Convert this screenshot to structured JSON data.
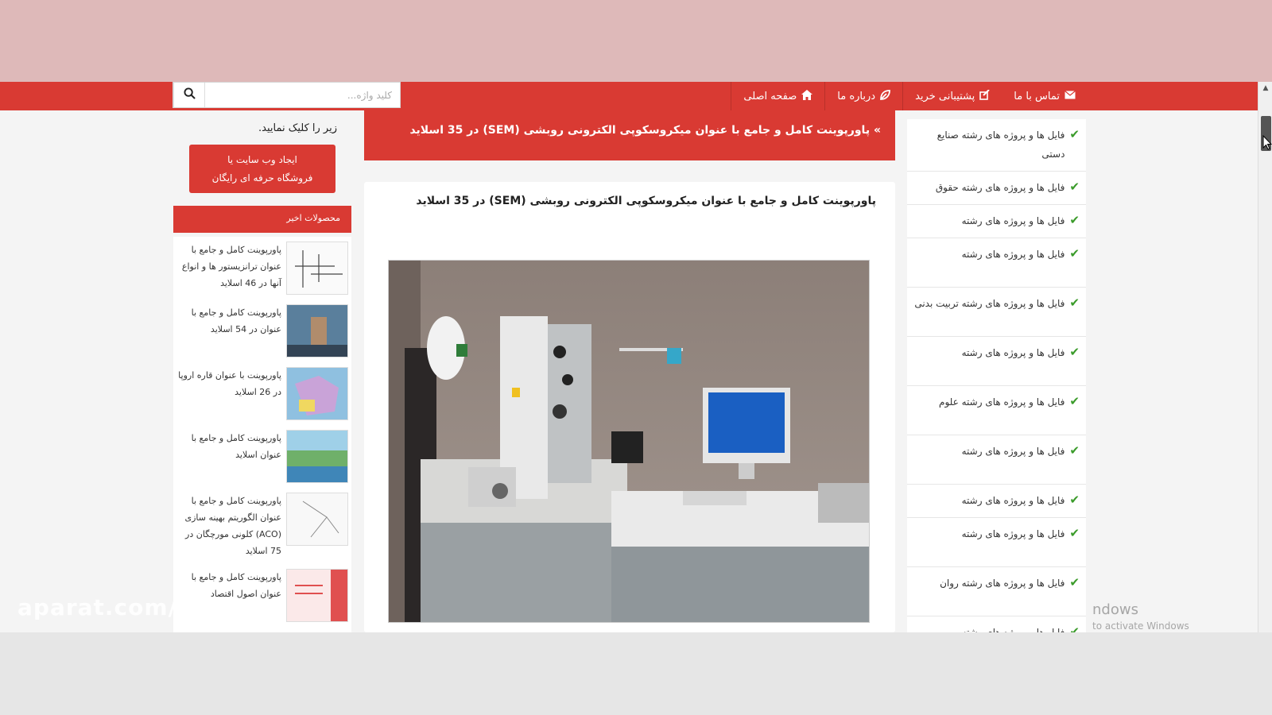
{
  "nav": {
    "items": [
      {
        "label": "صفحه اصلی",
        "icon": "home-icon"
      },
      {
        "label": "درباره ما",
        "icon": "leaf-icon"
      },
      {
        "label": "پشتیبانی خرید",
        "icon": "support-icon"
      },
      {
        "label": "تماس با ما",
        "icon": "envelope-icon"
      }
    ],
    "search_placeholder": "کلید واژه..."
  },
  "categories": [
    "فایل ها و پروژه های رشته صنایع دستی",
    "فایل ها و پروژه های رشته حقوق",
    "فایل ها و پروژه های رشته",
    "فایل ها و پروژه های رشته",
    "فایل ها و پروژه های رشته تربیت بدنی",
    "فایل ها و پروژه های رشته",
    "فایل ها و پروژه های رشته علوم",
    "فایل ها و پروژه های رشته",
    "فایل ها و پروژه های رشته",
    "فایل ها و پروژه های رشته",
    "فایل ها و پروژه های رشته روان",
    "فایل ها و پروژه های رشته"
  ],
  "main": {
    "banner_title": "پاورپوینت کامل و جامع با عنوان میکروسکوپی الکترونی روبشی (SEM) در 35 اسلاید",
    "banner_arrow": "»",
    "post_title": "پاورپوینت کامل و جامع با عنوان میکروسکوپی الکترونی روبشی (SEM) در 35 اسلاید"
  },
  "left": {
    "promo_text": "زیر را کلیک نمایید.",
    "promo_button_line1": "ایجاد وب سایت یا",
    "promo_button_line2": "فروشگاه حرفه ای رایگان",
    "recent_heading": "محصولات اخیر",
    "recent": [
      "پاورپوینت کامل و جامع با عنوان ترانزیستور ها و انواع آنها در 46 اسلاید",
      "پاورپوینت کامل و جامع با عنوان در 54 اسلاید",
      "پاورپوینت با عنوان قاره اروپا در 26 اسلاید",
      "پاورپوینت کامل و جامع با عنوان اسلاید",
      "پاورپوینت کامل و جامع با عنوان الگوریتم بهینه سازی (ACO) کلونی مورچگان در 75 اسلاید",
      "پاورپوینت کامل و جامع با عنوان اصول اقتصاد"
    ]
  },
  "overlay": {
    "watermark": "aparat.com/",
    "windows_line1": "ndows",
    "windows_line2": "to activate Windows"
  }
}
